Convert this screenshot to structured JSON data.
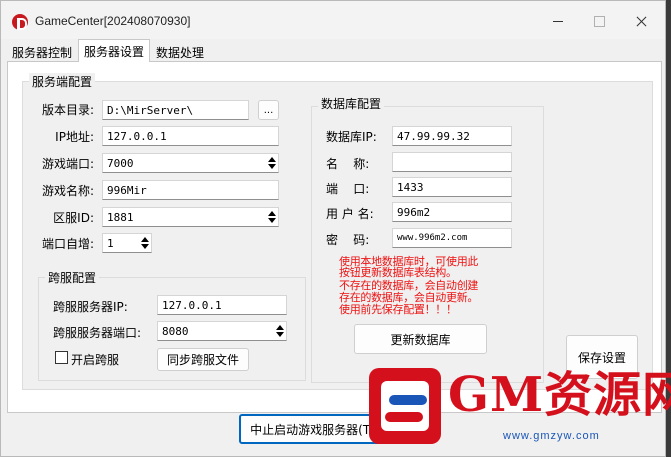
{
  "window": {
    "title": "GameCenter[202408070930]"
  },
  "tabs": [
    {
      "label": "服务器控制"
    },
    {
      "label": "服务器设置"
    },
    {
      "label": "数据处理"
    }
  ],
  "server_config": {
    "title": "服务端配置",
    "version_dir": {
      "label": "版本目录:",
      "value": "D:\\MirServer\\",
      "browse_label": "..."
    },
    "ip": {
      "label": "IP地址:",
      "value": "127.0.0.1"
    },
    "game_port": {
      "label": "游戏端口:",
      "value": "7000"
    },
    "game_name": {
      "label": "游戏名称:",
      "value": "996Mir"
    },
    "zone_id": {
      "label": "区服ID:",
      "value": "1881"
    },
    "port_increment": {
      "label": "端口自增:",
      "value": "1"
    }
  },
  "cross_server": {
    "title": "跨服配置",
    "server_ip": {
      "label": "跨服服务器IP:",
      "value": "127.0.0.1"
    },
    "server_port": {
      "label": "跨服服务器端口:",
      "value": "8080"
    },
    "enable": {
      "label": "开启跨服",
      "checked": false
    },
    "sync_button": "同步跨服文件"
  },
  "database_config": {
    "title": "数据库配置",
    "db_ip": {
      "label": "数据库IP:",
      "value": "47.99.99.32"
    },
    "name": {
      "label": "名    称:",
      "value": ""
    },
    "port": {
      "label": "端    口:",
      "value": "1433"
    },
    "username": {
      "label": "用 户 名:",
      "value": "996m2"
    },
    "password": {
      "label": "密    码:",
      "value": "www.996m2.com"
    },
    "note_lines": [
      "使用本地数据库时，可使用此",
      "按钮更新数据库表结构。",
      "不存在的数据库，会自动创建",
      "存在的数据库，会自动更新。",
      "使用前先保存配置！！！"
    ],
    "update_button": "更新数据库"
  },
  "actions": {
    "save": "保存设置",
    "stop_server": "中止启动游戏服务器(T)"
  },
  "watermark": {
    "text": "GM资源网",
    "url": "www.gmzyw.com"
  },
  "colors": {
    "note_red": "#ee1111",
    "focus_blue": "#0067c0",
    "watermark_red": "#d3101c",
    "watermark_blue": "#1a56b8"
  }
}
